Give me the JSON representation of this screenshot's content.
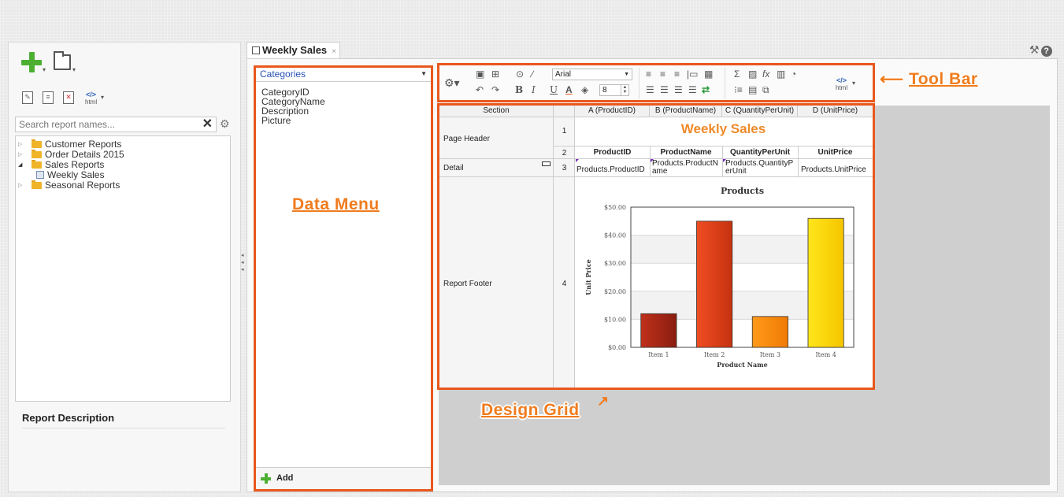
{
  "left_panel": {
    "search": {
      "placeholder": "Search report names..."
    },
    "tree": [
      {
        "label": "Customer Reports",
        "type": "folder",
        "expanded": false
      },
      {
        "label": "Order Details 2015",
        "type": "folder",
        "expanded": false
      },
      {
        "label": "Sales Reports",
        "type": "folder",
        "expanded": true
      },
      {
        "label": "Weekly Sales",
        "type": "report",
        "child": true
      },
      {
        "label": "Seasonal Reports",
        "type": "folder",
        "expanded": false
      }
    ],
    "report_description_label": "Report Description",
    "html_label": "html"
  },
  "tab": {
    "label": "Weekly Sales",
    "close": "×"
  },
  "data_menu": {
    "selected_table": "Categories",
    "fields": [
      "CategoryID",
      "CategoryName",
      "Description",
      "Picture"
    ],
    "add_label": "Add"
  },
  "toolbar": {
    "font_name": "Arial",
    "font_size": "8",
    "html_label": "html",
    "bold": "B",
    "italic": "I",
    "underline": "U",
    "font_color": "A",
    "sum": "Σ",
    "formula": "fx"
  },
  "annotations": {
    "tool_bar": "Tool Bar",
    "data_menu": "Data Menu",
    "design_grid": "Design Grid"
  },
  "design_grid": {
    "section_header": "Section",
    "columns": [
      "A (ProductID)",
      "B (ProductName)",
      "C (QuantityPerUnit)",
      "D (UnitPrice)"
    ],
    "sections": [
      "Page Header",
      "Detail",
      "Report Footer"
    ],
    "row_numbers": [
      "1",
      "2",
      "3",
      "4"
    ],
    "title": "Weekly Sales",
    "column_headers": [
      "ProductID",
      "ProductName",
      "QuantityPerUnit",
      "UnitPrice"
    ],
    "detail_cells": {
      "a": "Products.ProductID",
      "b1": "Products.ProductN",
      "b2": "ame",
      "c1": "Products.QuantityP",
      "c2": "erUnit",
      "d": "Products.UnitPrice"
    }
  },
  "chart_data": {
    "type": "bar",
    "title": "Products",
    "xlabel": "Product Name",
    "ylabel": "Unit Price",
    "categories": [
      "Item 1",
      "Item 2",
      "Item 3",
      "Item 4"
    ],
    "values": [
      12,
      45,
      11,
      46
    ],
    "ylim": [
      0,
      50
    ],
    "yticks": [
      0,
      10,
      20,
      30,
      40,
      50
    ],
    "ytick_labels": [
      "$0.00",
      "$10.00",
      "$20.00",
      "$30.00",
      "$40.00",
      "$50.00"
    ],
    "bar_colors": [
      [
        "#c0301b",
        "#8a1e10"
      ],
      [
        "#f04d22",
        "#c6320f"
      ],
      [
        "#ff9a1a",
        "#f07a05"
      ],
      [
        "#ffe61a",
        "#f5c500"
      ]
    ],
    "grid": true
  },
  "colors": {
    "accent_border": "#e9581d",
    "annotation": "#f07c1e",
    "title": "#ef8a2a",
    "add_green": "#4caf32"
  }
}
